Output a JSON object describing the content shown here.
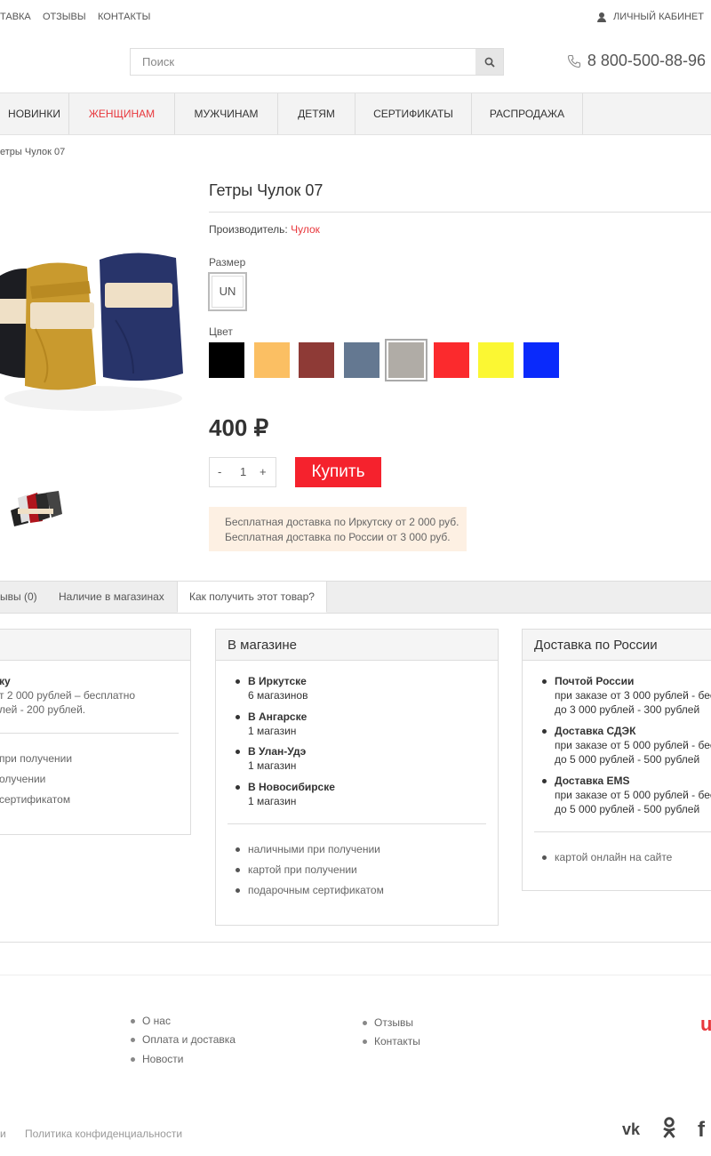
{
  "topnav": {
    "delivery": "ТАВКА",
    "reviews": "ОТЗЫВЫ",
    "contacts": "КОНТАКТЫ",
    "cabinet": "ЛИЧНЫЙ КАБИНЕТ"
  },
  "search": {
    "placeholder": "Поиск"
  },
  "phone": "8 800-500-88-96",
  "mainnav": [
    "НОВИНКИ",
    "ЖЕНЩИНАМ",
    "МУЖЧИНАМ",
    "ДЕТЯМ",
    "СЕРТИФИКАТЫ",
    "РАСПРОДАЖА"
  ],
  "breadcrumb": "етры Чулок 07",
  "product": {
    "title": "Гетры Чулок 07",
    "maker_label": "Производитель:",
    "maker": "Чулок",
    "size_label": "Размер",
    "size": "UN",
    "color_label": "Цвет",
    "colors": [
      "#000000",
      "#fbbf63",
      "#8e3a36",
      "#647891",
      "#b0aca6",
      "#fb2a2d",
      "#fbf733",
      "#0a2afb"
    ],
    "selected_color": "#b0aca6",
    "price": "400 ₽",
    "qty": {
      "minus": "-",
      "value": "1",
      "plus": "+"
    },
    "buy": "Купить",
    "delivery_1": "Бесплатная доставка по Иркутску от 2 000 руб.",
    "delivery_2": "Бесплатная доставка по России от 3 000 руб."
  },
  "tabs": {
    "reviews": "ывы (0)",
    "stock": "Наличие в магазинах",
    "how": "Как получить этот товар?"
  },
  "card1": {
    "city": "ку",
    "l1": "т 2 000 рублей – бесплатно",
    "l2": "лей - 200 рублей.",
    "p1": "при получении",
    "p2": "олучении",
    "p3": "сертификатом"
  },
  "card2": {
    "title": "В магазине",
    "shops": [
      {
        "city": "В Иркутске",
        "count": "6 магазинов"
      },
      {
        "city": "В Ангарске",
        "count": "1 магазин"
      },
      {
        "city": "В Улан-Удэ",
        "count": "1 магазин"
      },
      {
        "city": "В Новосибирске",
        "count": "1 магазин"
      }
    ],
    "pay": [
      "наличными при получении",
      "картой при получении",
      "подарочным сертификатом"
    ]
  },
  "card3": {
    "title": "Доставка по России",
    "methods": [
      {
        "name": "Почтой России",
        "l1": "при заказе от 3 000 рублей - бес",
        "l2": "до 3 000 рублей - 300 рублей"
      },
      {
        "name": "Доставка СДЭК",
        "l1": "при заказе от 5 000 рублей - бес",
        "l2": "до 5 000 рублей - 500 рублей"
      },
      {
        "name": "Доставка EMS",
        "l1": "при заказе от 5 000 рублей - бес",
        "l2": "до 5 000 рублей - 500 рублей"
      }
    ],
    "pay": "картой онлайн на сайте"
  },
  "footer": {
    "col1": [
      "О нас",
      "Оплата и доставка",
      "Новости"
    ],
    "col2": [
      "Отзывы",
      "Контакты"
    ],
    "policy": "Политика конфиденциальности",
    "left_fragment": "и",
    "logo_fragment": "u"
  }
}
